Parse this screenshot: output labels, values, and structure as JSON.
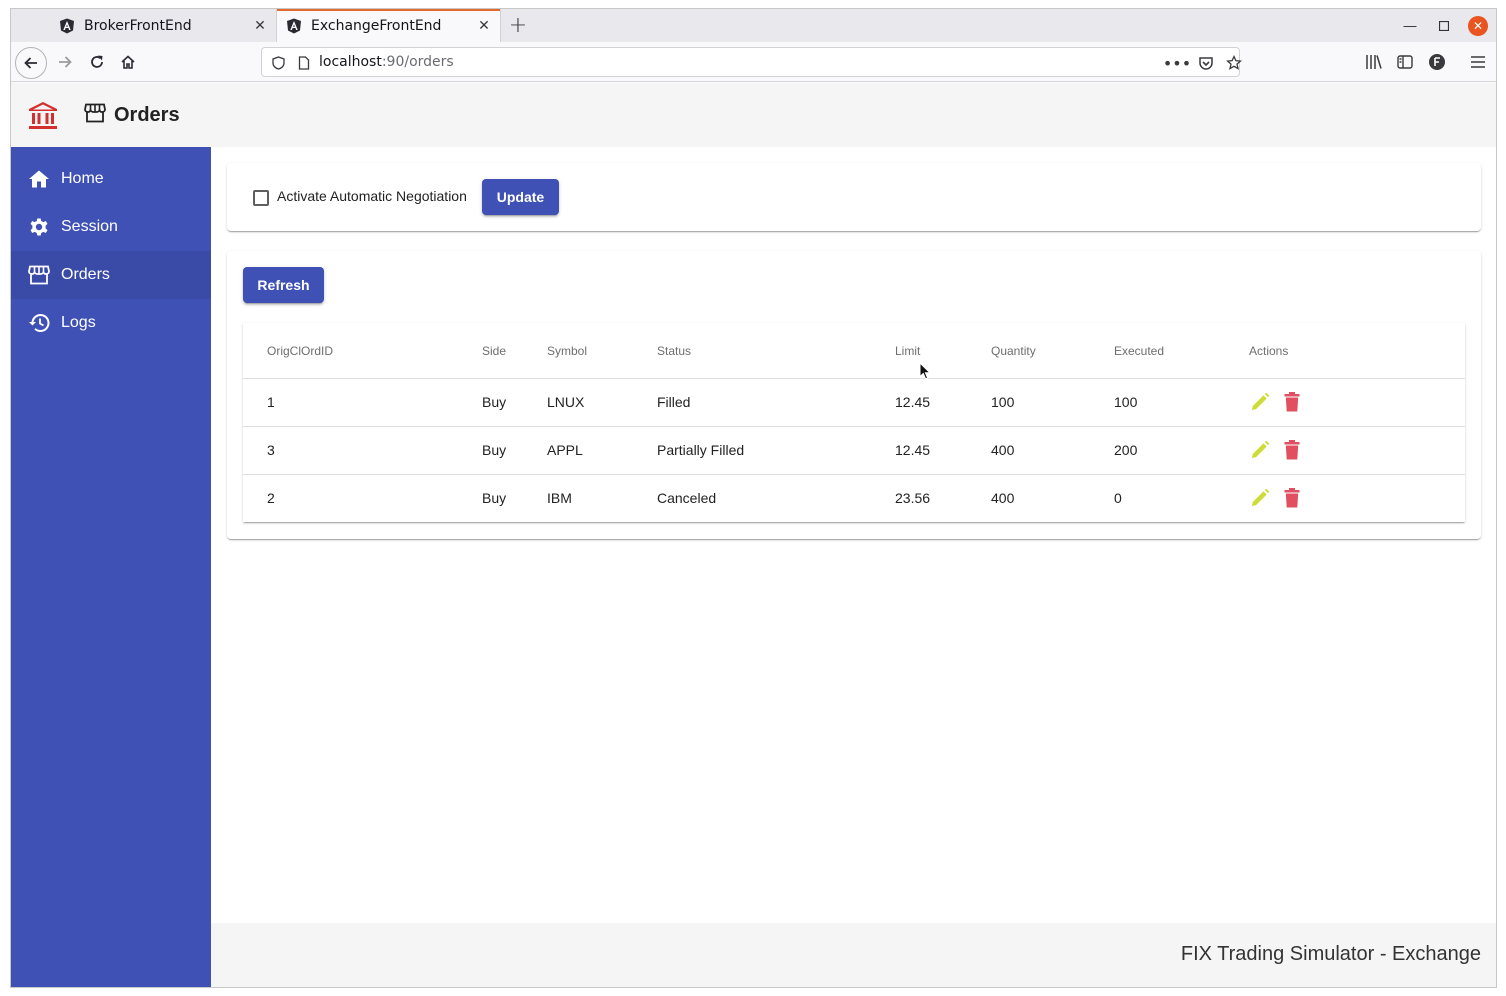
{
  "browser": {
    "tabs": [
      {
        "title": "BrokerFrontEnd",
        "active": false
      },
      {
        "title": "ExchangeFrontEnd",
        "active": true
      }
    ],
    "url_host": "localhost",
    "url_rest": ":90/orders",
    "accent_color": "#e06a2b"
  },
  "app": {
    "header_title": "Orders",
    "logo_icon": "bank-icon",
    "logo_color": "#d32f2f",
    "primary_color": "#3f51b5",
    "sidebar": {
      "items": [
        {
          "label": "Home",
          "icon": "home-icon"
        },
        {
          "label": "Session",
          "icon": "gear-icon"
        },
        {
          "label": "Orders",
          "icon": "store-icon",
          "selected": true
        },
        {
          "label": "Logs",
          "icon": "history-icon"
        }
      ]
    },
    "negotiation": {
      "checkbox_label": "Activate Automatic Negotiation",
      "checked": false,
      "update_label": "Update"
    },
    "orders": {
      "refresh_label": "Refresh",
      "columns": [
        "OrigClOrdID",
        "Side",
        "Symbol",
        "Status",
        "Limit",
        "Quantity",
        "Executed",
        "Actions"
      ],
      "rows": [
        {
          "id": "1",
          "side": "Buy",
          "symbol": "LNUX",
          "status": "Filled",
          "limit": "12.45",
          "quantity": "100",
          "executed": "100"
        },
        {
          "id": "3",
          "side": "Buy",
          "symbol": "APPL",
          "status": "Partially Filled",
          "limit": "12.45",
          "quantity": "400",
          "executed": "200"
        },
        {
          "id": "2",
          "side": "Buy",
          "symbol": "IBM",
          "status": "Canceled",
          "limit": "23.56",
          "quantity": "400",
          "executed": "0"
        }
      ],
      "edit_icon_color": "#cddc39",
      "delete_icon_color": "#e05060"
    },
    "footer_text": "FIX Trading Simulator - Exchange"
  }
}
